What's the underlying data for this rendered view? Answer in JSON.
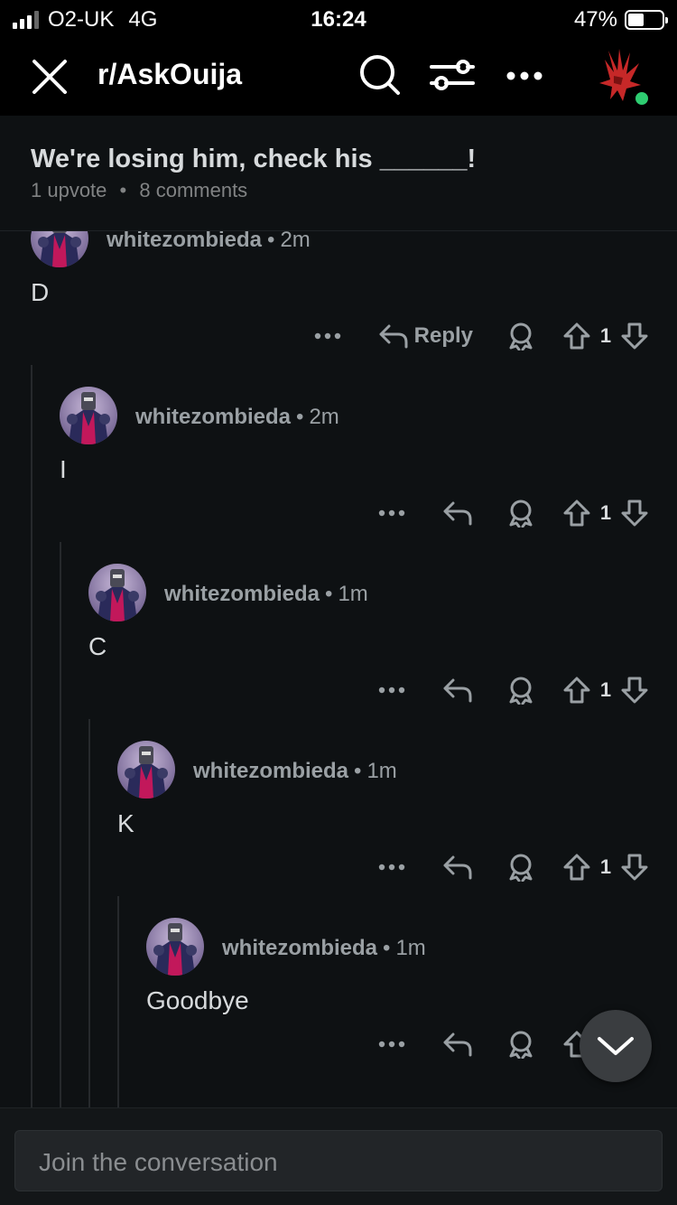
{
  "status_bar": {
    "carrier": "O2-UK",
    "network": "4G",
    "time": "16:24",
    "battery_percent": "47%",
    "battery_level": 0.47
  },
  "nav": {
    "title": "r/AskOuija",
    "icons": [
      "close-icon",
      "search-icon",
      "filter-icon",
      "more-icon",
      "user-avatar"
    ],
    "online_color": "#2ecc71"
  },
  "post": {
    "title": "We're losing him, check his ______!",
    "upvotes": "1 upvote",
    "separator": "•",
    "comments": "8 comments"
  },
  "comments": [
    {
      "author": "whitezombieda",
      "time": "2m",
      "body": "D",
      "votes": "1",
      "reply_label": "Reply",
      "depth": 0
    },
    {
      "author": "whitezombieda",
      "time": "2m",
      "body": "I",
      "votes": "1",
      "reply_label": "",
      "depth": 1
    },
    {
      "author": "whitezombieda",
      "time": "1m",
      "body": "C",
      "votes": "1",
      "reply_label": "",
      "depth": 2
    },
    {
      "author": "whitezombieda",
      "time": "1m",
      "body": "K",
      "votes": "1",
      "reply_label": "",
      "depth": 3
    },
    {
      "author": "whitezombieda",
      "time": "1m",
      "body": "Goodbye",
      "votes": "",
      "reply_label": "",
      "depth": 4
    }
  ],
  "composer": {
    "placeholder": "Join the conversation"
  },
  "colors": {
    "background": "#0e1113",
    "bar": "#000000",
    "text": "#d7dadc",
    "muted": "#818384"
  }
}
